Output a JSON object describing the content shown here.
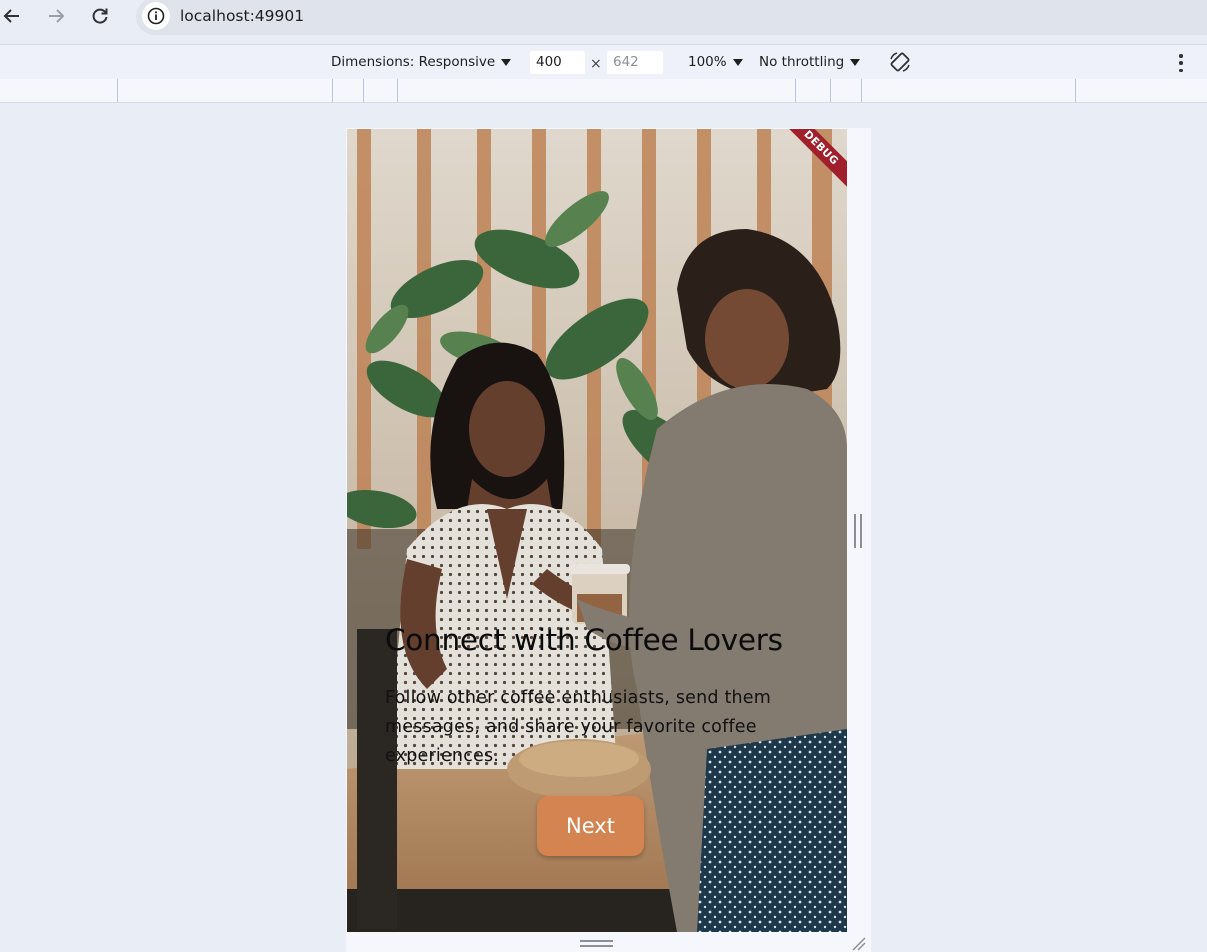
{
  "browser": {
    "url": "localhost:49901",
    "icons": {
      "back": "arrow-left-icon",
      "forward": "arrow-right-icon",
      "reload": "reload-icon",
      "site_info": "info-icon"
    }
  },
  "devtools": {
    "dimensions_label": "Dimensions: Responsive",
    "width_value": "400",
    "times": "×",
    "height_placeholder": "642",
    "zoom": "100%",
    "throttling": "No throttling",
    "icons": {
      "rotate": "rotate-icon",
      "more": "kebab-menu-icon"
    }
  },
  "app": {
    "debug_banner": "DEBUG",
    "title": "Connect with Coffee Lovers",
    "description": "Follow other coffee enthusiasts, send them messages, and share your favorite coffee experiences.",
    "next_label": "Next",
    "background_image": "two women exchanging a coffee cup in a cafe",
    "colors": {
      "button": "#d48450",
      "debug_ribbon": "#a11f2a"
    }
  }
}
